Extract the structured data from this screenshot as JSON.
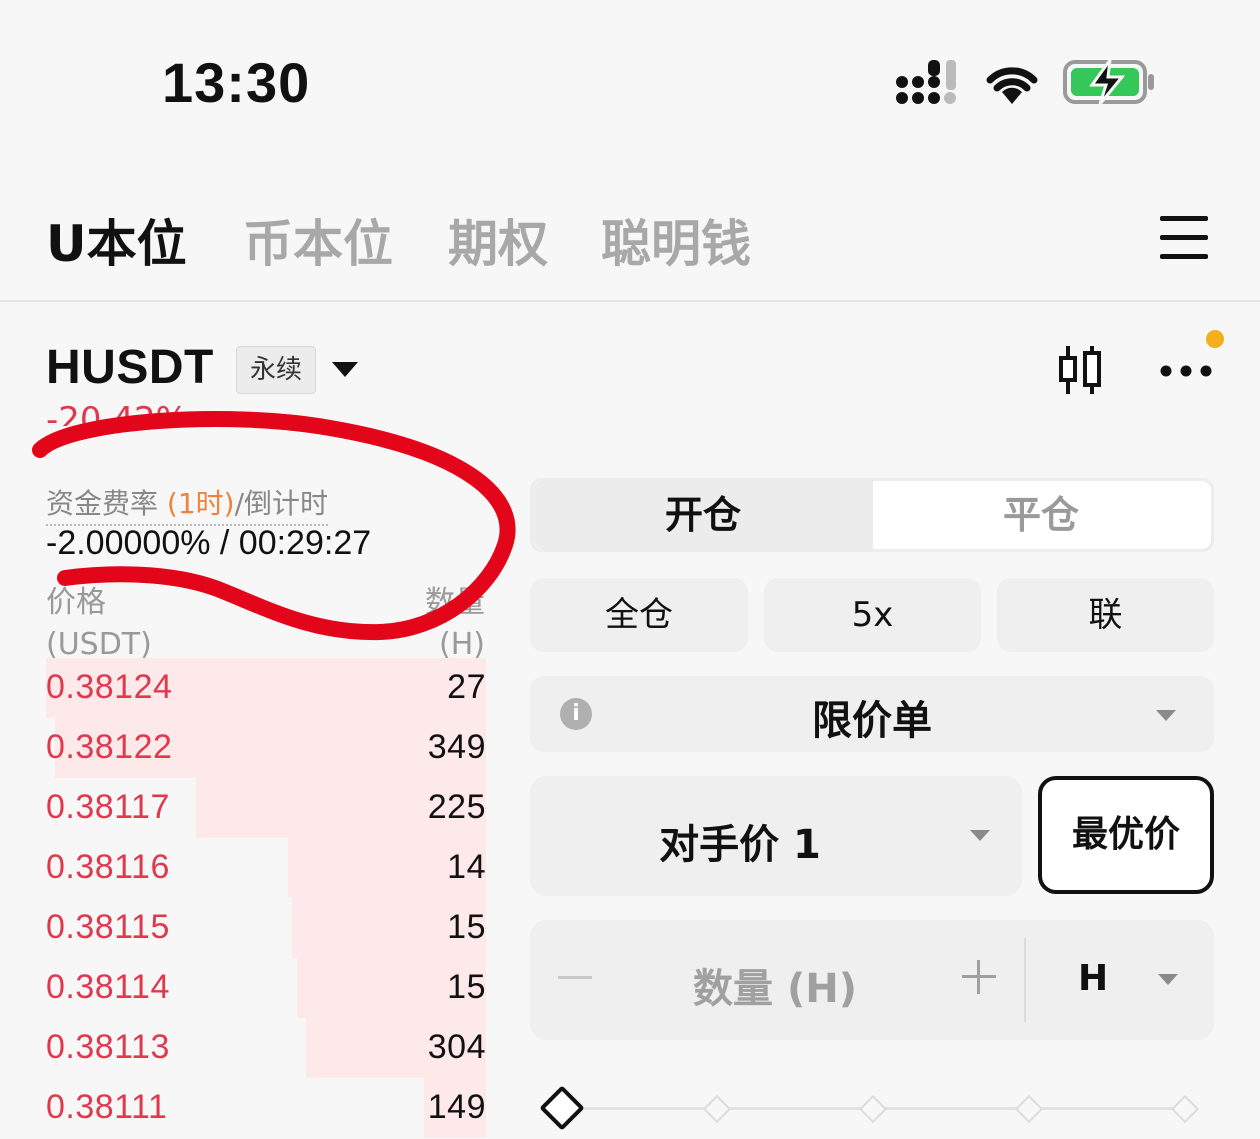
{
  "status": {
    "time": "13:30",
    "icons": [
      "signal-icon",
      "wifi-icon",
      "battery-charging-icon"
    ]
  },
  "tabs": [
    {
      "label": "U本位",
      "active": true
    },
    {
      "label": "币本位",
      "active": false
    },
    {
      "label": "期权",
      "active": false
    },
    {
      "label": "聪明钱",
      "active": false
    }
  ],
  "header": {
    "symbol": "HUSDT",
    "badge": "永续",
    "change": "-20.42%"
  },
  "funding": {
    "label_a": "资金费率 ",
    "label_period": "(1时)",
    "label_b": "/倒计时",
    "value": "-2.00000% / 00:29:27"
  },
  "orderbook": {
    "price_header": "价格",
    "price_unit": "(USDT)",
    "qty_header": "数量",
    "qty_unit": "(H)",
    "asks": [
      {
        "price": "0.38124",
        "qty": "27",
        "depth": 1.0
      },
      {
        "price": "0.38122",
        "qty": "349",
        "depth": 0.98
      },
      {
        "price": "0.38117",
        "qty": "225",
        "depth": 0.66
      },
      {
        "price": "0.38116",
        "qty": "14",
        "depth": 0.45
      },
      {
        "price": "0.38115",
        "qty": "15",
        "depth": 0.44
      },
      {
        "price": "0.38114",
        "qty": "15",
        "depth": 0.43
      },
      {
        "price": "0.38113",
        "qty": "304",
        "depth": 0.41
      },
      {
        "price": "0.38111",
        "qty": "149",
        "depth": 0.14
      }
    ]
  },
  "trade": {
    "open_label": "开仓",
    "close_label": "平仓",
    "margin_mode": "全仓",
    "leverage": "5x",
    "third_pill": "联",
    "order_type": "限价单",
    "price_mode": "对手价 1",
    "best_price": "最优价",
    "qty_placeholder": "数量 (H)",
    "unit": "H"
  },
  "colors": {
    "ask": "#e0394e",
    "ask_bg": "#fde8ea",
    "accent_dot": "#f2b01e",
    "annotation": "#e3061a"
  }
}
